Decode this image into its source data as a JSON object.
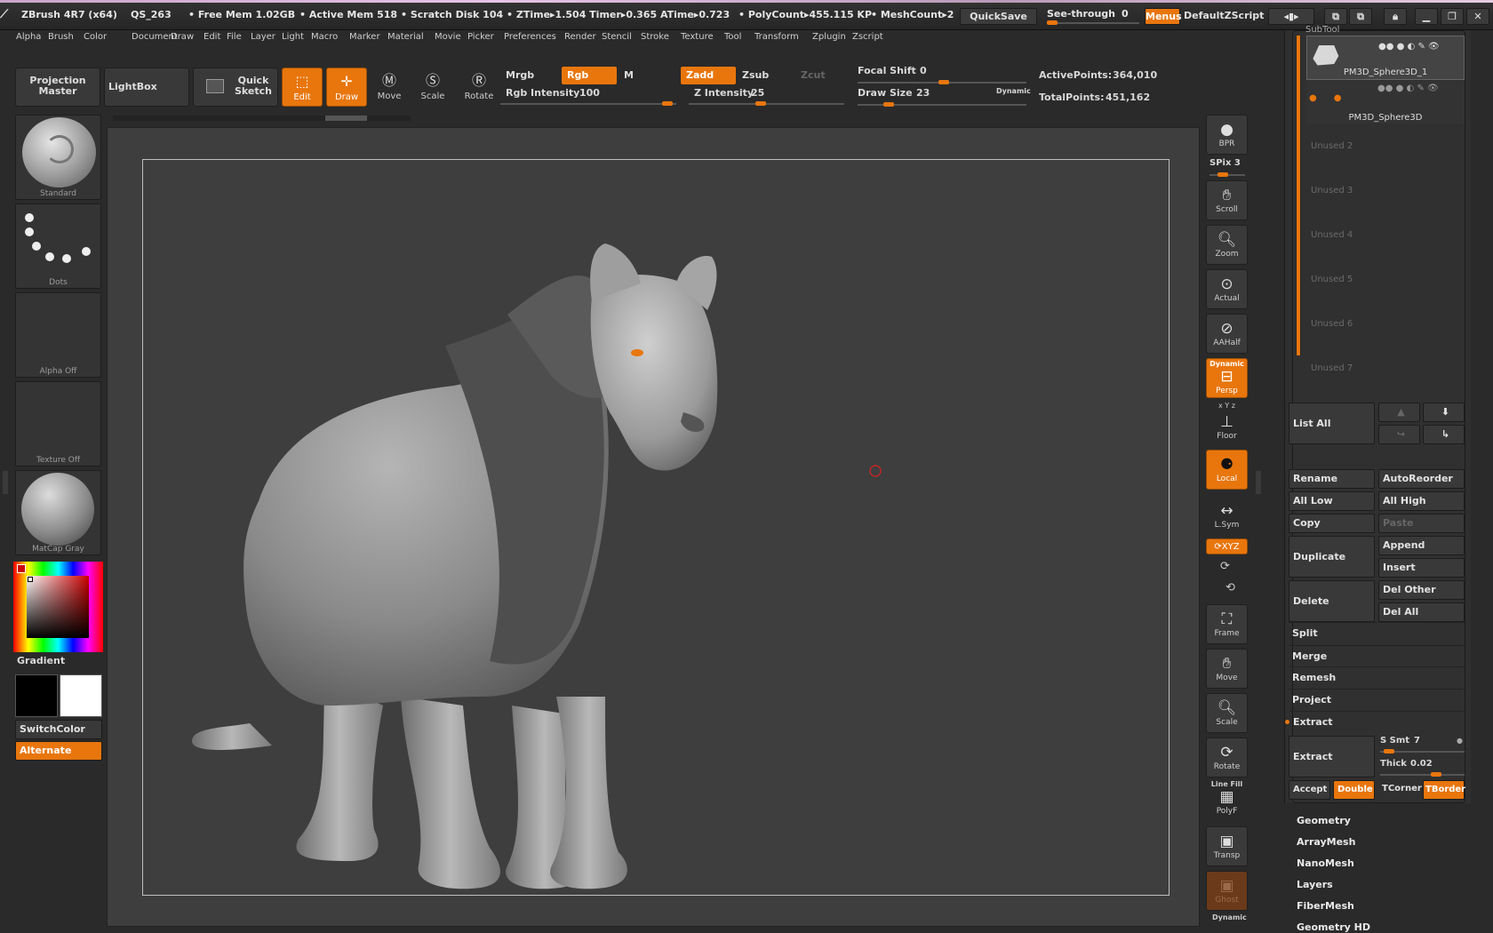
{
  "statusbar": {
    "app_title": "ZBrush 4R7 (x64)",
    "file": "QS_263",
    "free_mem": "• Free Mem 1.02GB",
    "active_mem": "• Active Mem 518",
    "scratch_disk": "• Scratch Disk 104",
    "ztime": "• ZTime▸1.504 Timer▸0.365 ATime▸0.723",
    "polycount": "• PolyCount▸455.115 KP",
    "meshcount": "• MeshCount▸2",
    "quicksave": "QuickSave",
    "see_through": "See-through",
    "see_through_value": "0",
    "menus": "Menus",
    "script": "DefaultZScript"
  },
  "menubar": [
    "Alpha",
    "Brush",
    "Color",
    "Document",
    "Draw",
    "Edit",
    "File",
    "Layer",
    "Light",
    "Macro",
    "Marker",
    "Material",
    "Movie",
    "Picker",
    "Preferences",
    "Render",
    "Stencil",
    "Stroke",
    "Texture",
    "Tool",
    "Transform",
    "Zplugin",
    "Zscript"
  ],
  "toolbar": {
    "projection_master": "Projection Master",
    "lightbox": "LightBox",
    "quick_sketch": "Quick Sketch",
    "edit": "Edit",
    "draw": "Draw",
    "move": "Move",
    "scale": "Scale",
    "rotate": "Rotate",
    "mrgb": "Mrgb",
    "rgb": "Rgb",
    "m": "M",
    "zadd": "Zadd",
    "zsub": "Zsub",
    "zcut": "Zcut",
    "rgb_intensity_label": "Rgb Intensity",
    "rgb_intensity_value": "100",
    "z_intensity_label": "Z Intensity",
    "z_intensity_value": "25",
    "focal_shift_label": "Focal Shift",
    "focal_shift_value": "0",
    "draw_size_label": "Draw Size",
    "draw_size_value": "23",
    "dynamic": "Dynamic",
    "active_points_label": "ActivePoints:",
    "active_points_value": "364,010",
    "total_points_label": "TotalPoints:",
    "total_points_value": "451,162"
  },
  "left_shelf": {
    "brush": "Standard",
    "stroke": "Dots",
    "alpha": "Alpha Off",
    "texture": "Texture Off",
    "material": "MatCap Gray",
    "gradient": "Gradient",
    "switch_color": "SwitchColor",
    "alternate": "Alternate"
  },
  "right_shelf": {
    "bpr": "BPR",
    "spix_label": "SPix",
    "spix_value": "3",
    "scroll": "Scroll",
    "zoom": "Zoom",
    "actual": "Actual",
    "aahalf": "AAHalf",
    "persp_top": "Dynamic",
    "persp": "Persp",
    "floor_top": "x Y z",
    "floor": "Floor",
    "local": "Local",
    "lsym": "L.Sym",
    "xyz": "XYZ",
    "frame": "Frame",
    "move": "Move",
    "scale": "Scale",
    "rotate": "Rotate",
    "polyf_top": "Line Fill",
    "polyf": "PolyF",
    "transp": "Transp",
    "ghost": "Ghost",
    "dynamic_bottom": "Dynamic"
  },
  "subtool": {
    "header": "SubTool",
    "items": [
      "PM3D_Sphere3D_1",
      "PM3D_Sphere3D"
    ],
    "unused": [
      "Unused 2",
      "Unused 3",
      "Unused 4",
      "Unused 5",
      "Unused 6",
      "Unused 7"
    ],
    "list_all": "List All",
    "rename": "Rename",
    "autoreorder": "AutoReorder",
    "all_low": "All Low",
    "all_high": "All High",
    "copy": "Copy",
    "paste": "Paste",
    "duplicate": "Duplicate",
    "append": "Append",
    "insert": "Insert",
    "delete": "Delete",
    "del_other": "Del Other",
    "del_all": "Del All",
    "split": "Split",
    "merge": "Merge",
    "remesh": "Remesh",
    "project": "Project",
    "extract_header": "Extract",
    "extract": "Extract",
    "s_smt_label": "S Smt",
    "s_smt_value": "7",
    "thick_label": "Thick",
    "thick_value": "0.02",
    "accept": "Accept",
    "double": "Double",
    "tcorner": "TCorner",
    "tborder": "TBorder"
  },
  "tool_sections": [
    "Geometry",
    "ArrayMesh",
    "NanoMesh",
    "Layers",
    "FiberMesh",
    "Geometry HD"
  ],
  "colors": {
    "accent": "#e8760d",
    "bg": "#2a2a2a",
    "canvas": "#3e3e3e"
  }
}
